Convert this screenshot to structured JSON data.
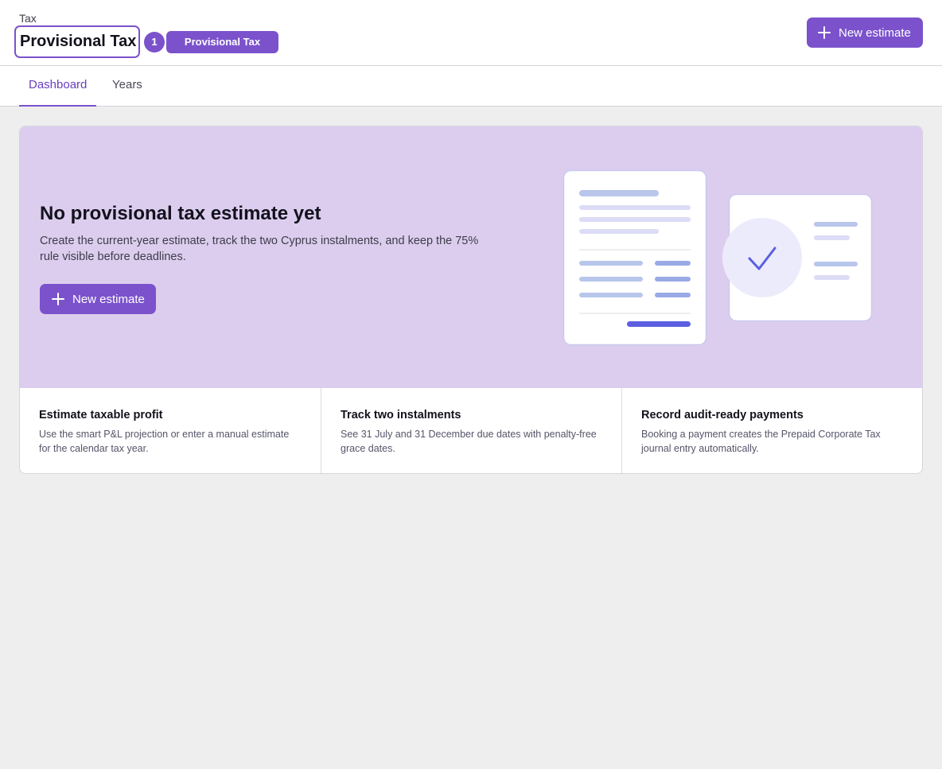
{
  "header": {
    "breadcrumb": "Tax",
    "title": "Provisional Tax",
    "badge_count": "1",
    "title_pill": "Provisional Tax",
    "new_estimate_label": "New estimate"
  },
  "tabs": [
    {
      "label": "Dashboard",
      "active": true
    },
    {
      "label": "Years",
      "active": false
    }
  ],
  "hero": {
    "title": "No provisional tax estimate yet",
    "text": "Create the current-year estimate, track the two Cyprus instalments, and keep the 75% rule visible before deadlines.",
    "button_label": "New estimate",
    "illustration_icons": [
      "document-icon",
      "check-icon"
    ]
  },
  "features": [
    {
      "title": "Estimate taxable profit",
      "text": "Use the smart P&L projection or enter a manual estimate for the calendar tax year."
    },
    {
      "title": "Track two instalments",
      "text": "See 31 July and 31 December due dates with penalty-free grace dates."
    },
    {
      "title": "Record audit-ready payments",
      "text": "Booking a payment creates the Prepaid Corporate Tax journal entry automatically."
    }
  ],
  "colors": {
    "accent": "#7b52cc",
    "hero_background": "#dccdee",
    "page_background": "#eeeeee"
  }
}
